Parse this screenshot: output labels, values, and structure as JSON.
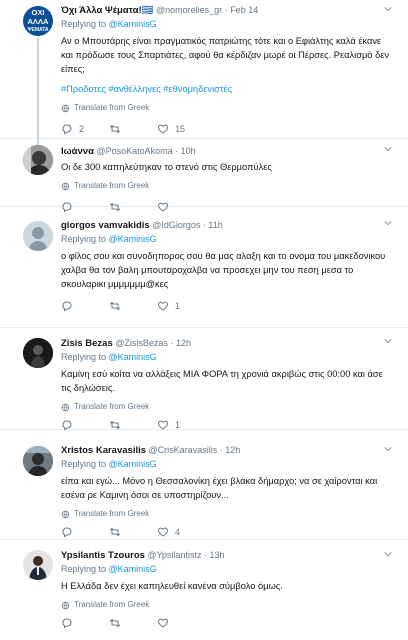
{
  "tweets": [
    {
      "name": "Όχι Άλλα Ψέματα!🇬🇷",
      "handle": "@nomorelies_gr",
      "dot": "·",
      "time": "Feb 14",
      "replying_prefix": "Replying to ",
      "replying_to": "@KaminisG",
      "text": "Αν ο Μπουτάρης είναι πραγματικός πατριώτης τότε και ο Εφιάλτης καλά έκανε και πρόδωσε τους Σπαρτιάτες, αφού θα κέρδιζαν μωρέ οι Πέρσες. Ρεαλισμό δεν είπες;",
      "hashtags": "#Προδοτες #ανθέλληνες #εθνομηδενιστές",
      "translate": "Translate from Greek",
      "reply_count": "2",
      "retweet_count": "",
      "like_count": "15",
      "avatar_label": [
        "ΟΧΙ",
        "ΑΛΛΑ",
        "ΨΕΜΑΤΑ"
      ]
    },
    {
      "name": "Ιωάννα",
      "handle": "@PosoKatoAkoma",
      "dot": "·",
      "time": "10h",
      "text": "Οι δε 300 καπηλεύτηκαν το στενό στις Θερμοπύλες",
      "translate": "Translate from Greek",
      "reply_count": "",
      "retweet_count": "",
      "like_count": ""
    },
    {
      "name": "giorgos vamvakidis",
      "handle": "@IdGiorgos",
      "dot": "·",
      "time": "11h",
      "replying_prefix": "Replying to ",
      "replying_to": "@KaminisG",
      "text": "ο φίλος σου και συνοδηπορος σου θα μας αλαξη και το ονομα του μακεδονικου χαλβα θα τον βαλη μπουταροχαλβα να προσεχει μην του πεση μεσα το σκουλαρικι μμμμμμμ@κες",
      "reply_count": "",
      "retweet_count": "",
      "like_count": "1"
    },
    {
      "name": "Zisis Bezas",
      "handle": "@ZisisBezas",
      "dot": "·",
      "time": "12h",
      "replying_prefix": "Replying to ",
      "replying_to": "@KaminisG",
      "text": "Καμίνη εσύ κοίτα να αλλάξεις ΜΙΑ ΦΟΡΑ τη χρονιά ακριβώς στις 00:00 και άσε τις δηλώσεις.",
      "translate": "Translate from Greek",
      "reply_count": "",
      "retweet_count": "",
      "like_count": "1"
    },
    {
      "name": "Xristos Karavasilis",
      "handle": "@CrisKaravasilis",
      "dot": "·",
      "time": "12h",
      "replying_prefix": "Replying to ",
      "replying_to": "@KaminisG",
      "text": "είπα και εγώ... Μόνο η Θεσσαλονίκη έχει βλάκα δήμαρχο; να σε χαίρονται και εσένα ρε Καμινη όσοι σε υποστηρίζουν...",
      "translate": "Translate from Greek",
      "reply_count": "",
      "retweet_count": "",
      "like_count": "4"
    },
    {
      "name": "Ypsilantis Tzouros",
      "handle": "@Ypsilantistz",
      "dot": "·",
      "time": "13h",
      "replying_prefix": "Replying to ",
      "replying_to": "@KaminisG",
      "text": "Η Ελλάδα δεν έχει καπηλευθεί κανένα σύμβολο όμως.",
      "translate": "Translate from Greek",
      "reply_count": "",
      "retweet_count": "",
      "like_count": ""
    }
  ],
  "colors": {
    "link": "#1b95e0",
    "muted": "#657786",
    "text": "#14171a",
    "border": "#e6ecf0",
    "thread": "#c6d5e0"
  },
  "icons": [
    "reply-icon",
    "retweet-icon",
    "like-icon",
    "globe-icon",
    "caret-down-icon",
    "flag-icon"
  ]
}
